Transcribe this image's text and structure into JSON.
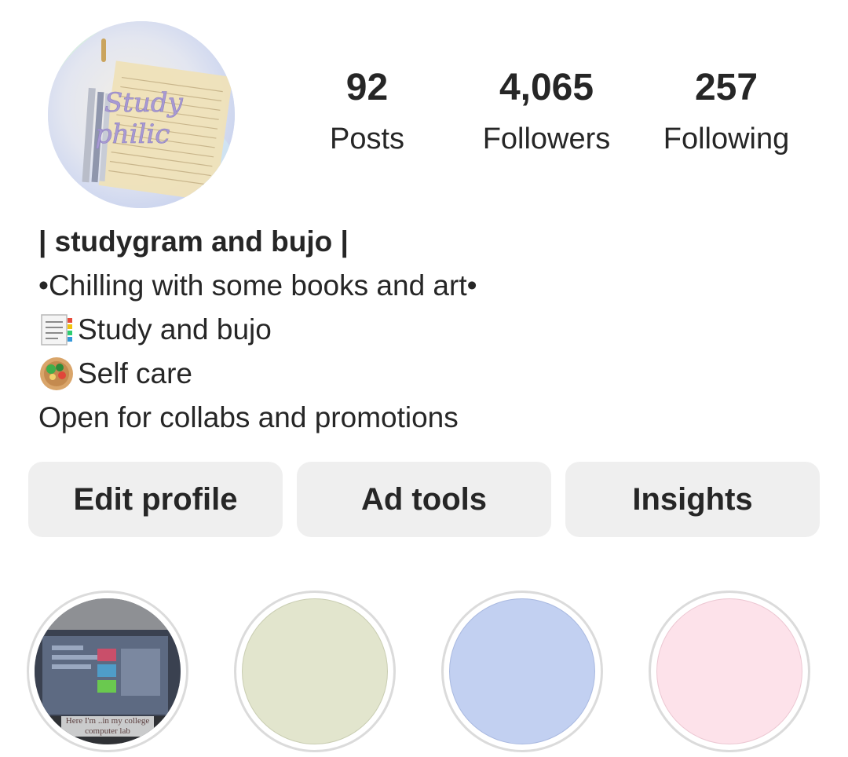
{
  "profile": {
    "avatar_text": "Study philic",
    "stats": [
      {
        "value": "92",
        "label": "Posts"
      },
      {
        "value": "4,065",
        "label": "Followers"
      },
      {
        "value": "257",
        "label": "Following"
      }
    ]
  },
  "bio": {
    "name": "| studygram and bujo |",
    "lines": [
      {
        "icon": "notebook-icon",
        "text": "•Chilling with some books and art•"
      },
      {
        "icon": "notebook-icon",
        "text": "Study and bujo"
      },
      {
        "icon": "salad-bowl-icon",
        "text": "Self care"
      },
      {
        "icon": "",
        "text": "Open for collabs and promotions"
      }
    ]
  },
  "actions": {
    "edit_profile": "Edit profile",
    "ad_tools": "Ad tools",
    "insights": "Insights"
  },
  "highlights": [
    {
      "caption": "Here I'm ..in my college computer lab",
      "color": null
    },
    {
      "caption": "",
      "color": "#e2e5cd"
    },
    {
      "caption": "",
      "color": "#c2d0f1"
    },
    {
      "caption": "",
      "color": "#fde2ea"
    }
  ],
  "colors": {
    "text": "#262626",
    "button_bg": "#efefef",
    "ring": "#dbdbdb"
  }
}
